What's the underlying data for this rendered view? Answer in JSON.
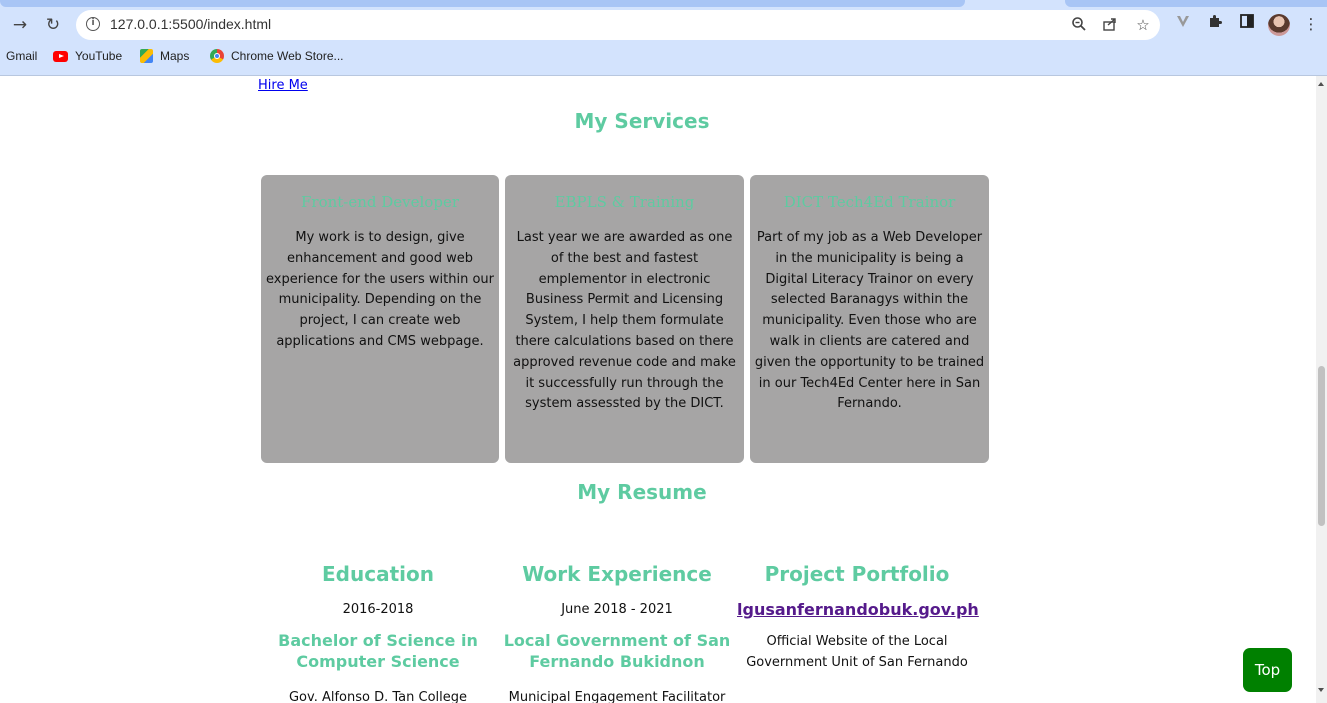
{
  "browser": {
    "url": "127.0.0.1:5500/index.html",
    "bookmarks": [
      {
        "label": "Gmail"
      },
      {
        "label": "YouTube"
      },
      {
        "label": "Maps"
      },
      {
        "label": "Chrome Web Store..."
      }
    ]
  },
  "page": {
    "hire_link": "Hire Me",
    "services": {
      "title": "My Services",
      "cards": [
        {
          "title": "Front-end Developer",
          "text": "My work is to design, give enhancement and good web experience for the users within our municipality. Depending on the project, I can create web applications and CMS webpage."
        },
        {
          "title": "EBPLS & Training",
          "text": "Last year we are awarded as one of the best and fastest emplementor in electronic Business Permit and Licensing System, I help them formulate there calculations based on there approved revenue code and make it successfully run through the system assessted by the DICT."
        },
        {
          "title": "DICT Tech4Ed Trainor",
          "text": "Part of my job as a Web Developer in the municipality is being a Digital Literacy Trainor on every selected Baranagys within the municipality. Even those who are walk in clients are catered and given the opportunity to be trained in our Tech4Ed Center here in San Fernando."
        }
      ]
    },
    "resume": {
      "title": "My Resume",
      "education": {
        "heading": "Education",
        "years": "2016-2018",
        "degree": "Bachelor of Science in Computer Science",
        "cut_text": "Gov. Alfonso D. Tan College"
      },
      "work": {
        "heading": "Work Experience",
        "years": "June 2018 - 2021",
        "employer": "Local Government of San Fernando Bukidnon",
        "cut_text": "Municipal Engagement Facilitator"
      },
      "projects": {
        "heading": "Project Portfolio",
        "link": "lgusanfernandobuk.gov.ph",
        "description": "Official Website of the Local Government Unit of San Fernando"
      }
    },
    "top_button": "Top"
  }
}
